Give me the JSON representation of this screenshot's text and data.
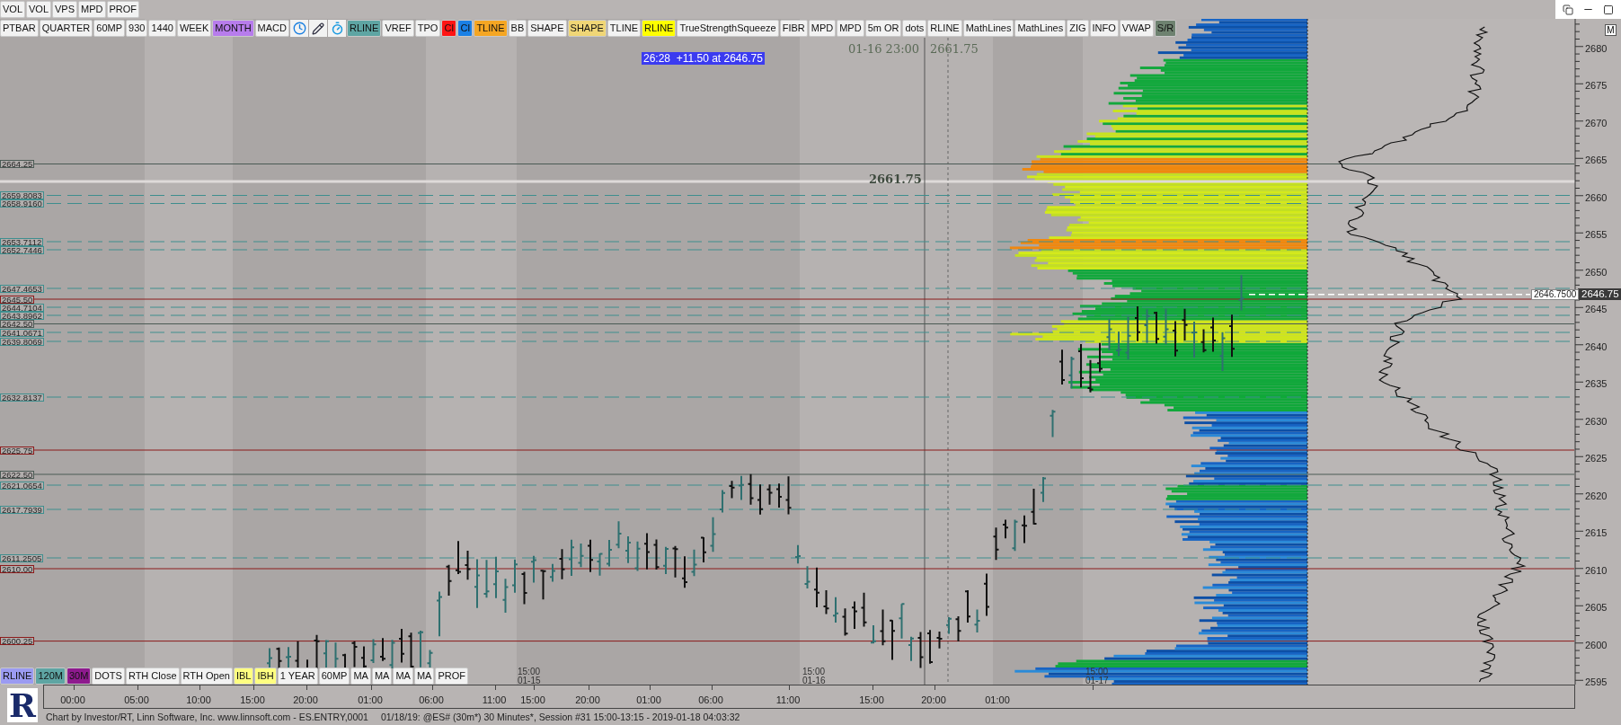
{
  "top_toolbar": [
    {
      "label": "VOL"
    },
    {
      "label": "VOL"
    },
    {
      "label": "VPS"
    },
    {
      "label": "MPD"
    },
    {
      "label": "PROF"
    }
  ],
  "toolbar": [
    {
      "kind": "button",
      "label": "PTBAR"
    },
    {
      "kind": "button",
      "label": "QUARTER"
    },
    {
      "kind": "button",
      "label": "60MP"
    },
    {
      "kind": "button",
      "label": "930"
    },
    {
      "kind": "button",
      "label": "1440"
    },
    {
      "kind": "button",
      "label": "WEEK"
    },
    {
      "kind": "button",
      "label": "MONTH",
      "color": "#b77cec"
    },
    {
      "kind": "button",
      "label": "MACD"
    },
    {
      "kind": "clock"
    },
    {
      "kind": "pencil"
    },
    {
      "kind": "stopwatch"
    },
    {
      "kind": "button",
      "label": "RLINE",
      "color": "#5ea5a3"
    },
    {
      "kind": "button",
      "label": "VREF"
    },
    {
      "kind": "button",
      "label": "TPO"
    },
    {
      "kind": "button",
      "label": "CI",
      "color": "#ff1414"
    },
    {
      "kind": "button",
      "label": "CI",
      "color": "#1a80e6"
    },
    {
      "kind": "button",
      "label": "TLINE",
      "color": "#f5a623"
    },
    {
      "kind": "button",
      "label": "BB"
    },
    {
      "kind": "button",
      "label": "SHAPE"
    },
    {
      "kind": "button",
      "label": "SHAPE",
      "color": "#f0d676"
    },
    {
      "kind": "button",
      "label": "TLINE"
    },
    {
      "kind": "button",
      "label": "RLINE",
      "color": "#ffff00"
    },
    {
      "kind": "button",
      "label": "TrueStrengthSqueeze"
    },
    {
      "kind": "button",
      "label": "FIBR"
    },
    {
      "kind": "button",
      "label": "MPD"
    },
    {
      "kind": "button",
      "label": "MPD"
    },
    {
      "kind": "button",
      "label": "5m OR"
    },
    {
      "kind": "button",
      "label": "dots"
    },
    {
      "kind": "button",
      "label": "RLINE"
    },
    {
      "kind": "button",
      "label": "MathLines"
    },
    {
      "kind": "button",
      "label": "MathLines"
    },
    {
      "kind": "button",
      "label": "ZIG"
    },
    {
      "kind": "button",
      "label": "INFO"
    },
    {
      "kind": "button",
      "label": "VWAP"
    },
    {
      "kind": "button",
      "label": "S/R",
      "color": "#6e8270"
    }
  ],
  "crosshair": {
    "time": "01-16 23:00",
    "price": "2661.75",
    "chart_label": "2661.75"
  },
  "bar_info": "26:28  +11.50 at 2646.75",
  "levels": [
    {
      "label": "2664.25",
      "kind": "solid",
      "color": "#4b5a55"
    },
    {
      "label": "2659.8083",
      "kind": "dashed",
      "color": "#3e8e8e"
    },
    {
      "label": "2658.9160",
      "kind": "dashed",
      "color": "#3e8e8e"
    },
    {
      "label": "2653.7112",
      "kind": "dashed",
      "color": "#3e8e8e"
    },
    {
      "label": "2652.7446",
      "kind": "dashed",
      "color": "#3e8e8e"
    },
    {
      "label": "2647.4653",
      "kind": "dashed",
      "color": "#3e8e8e"
    },
    {
      "label": "2645.50",
      "kind": "solid",
      "color": "#8b1a1a"
    },
    {
      "label": "2644.7104",
      "kind": "dashed",
      "color": "#3e8e8e"
    },
    {
      "label": "2643.8962",
      "kind": "dashed",
      "color": "#3e8e8e"
    },
    {
      "label": "2642.50",
      "kind": "solid",
      "color": "#4b5a55"
    },
    {
      "label": "2641.0671",
      "kind": "dashed",
      "color": "#3e8e8e"
    },
    {
      "label": "2639.8069",
      "kind": "dashed",
      "color": "#3e8e8e"
    },
    {
      "label": "2632.8137",
      "kind": "dashed",
      "color": "#3e8e8e"
    },
    {
      "label": "2625.75",
      "kind": "solid",
      "color": "#8b1a1a"
    },
    {
      "label": "2622.50",
      "kind": "solid",
      "color": "#4b5a55"
    },
    {
      "label": "2621.0654",
      "kind": "dashed",
      "color": "#3e8e8e"
    },
    {
      "label": "2617.7939",
      "kind": "dashed",
      "color": "#3e8e8e"
    },
    {
      "label": "2611.2505",
      "kind": "dashed",
      "color": "#3e8e8e"
    },
    {
      "label": "2610.00",
      "kind": "solid",
      "color": "#8b1a1a"
    },
    {
      "label": "2600.25",
      "kind": "solid",
      "color": "#8b1a1a"
    }
  ],
  "price_axis": {
    "button": "M",
    "labels": [
      "2680",
      "2675",
      "2670",
      "2665",
      "2660",
      "2655",
      "2650",
      "2645",
      "2640",
      "2635",
      "2630",
      "2625",
      "2620",
      "2615",
      "2610",
      "2605",
      "2600",
      "2595"
    ],
    "current_price": "2646.75",
    "cursor_value": "2646.7500"
  },
  "session_labels": [
    {
      "time": "15:00",
      "date": "01-15"
    },
    {
      "time": "15:00",
      "date": "01-16"
    },
    {
      "time": "15:00",
      "date": "01-17"
    }
  ],
  "bottom_toolbar": [
    {
      "label": "RLINE",
      "color": "#9b9bf2"
    },
    {
      "label": "120M",
      "color": "#5ea5a3"
    },
    {
      "label": "30M",
      "color": "#8e1a8e"
    },
    {
      "label": "DOTS"
    },
    {
      "label": "RTH Close"
    },
    {
      "label": "RTH Open"
    },
    {
      "label": "IBL",
      "color": "#ffff80"
    },
    {
      "label": "IBH",
      "color": "#ffff80"
    },
    {
      "label": "1 YEAR"
    },
    {
      "label": "60MP"
    },
    {
      "label": "MA"
    },
    {
      "label": "MA"
    },
    {
      "label": "MA"
    },
    {
      "label": "MA"
    },
    {
      "label": "PROF"
    }
  ],
  "time_axis": [
    "00:00",
    "05:00",
    "10:00",
    "15:00",
    "20:00",
    "01:00",
    "06:00",
    "11:00",
    "15:00",
    "20:00",
    "01:00",
    "06:00",
    "11:00",
    "15:00",
    "20:00",
    "01:00"
  ],
  "logo": "R",
  "status_bar": {
    "source": "Chart by Investor/RT, Linn Software, Inc. www.linnsoft.com - ES.ENTRY,0001",
    "session": "01/18/19: @ES# (30m*) 30 Minutes*, Session #31 15:00-13:15 - 2019-01-18 04:03:32"
  }
}
